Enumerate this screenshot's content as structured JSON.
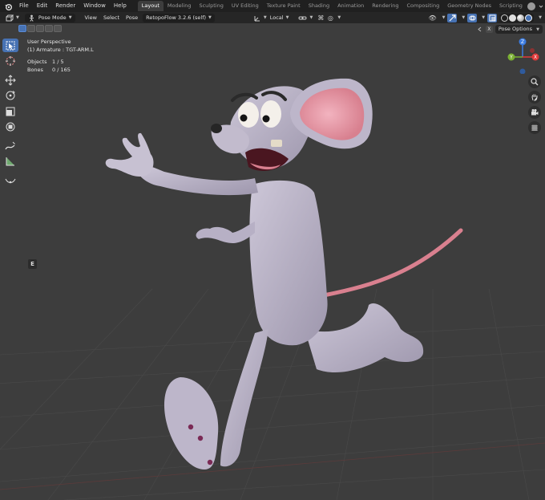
{
  "menu": {
    "items": [
      "File",
      "Edit",
      "Render",
      "Window",
      "Help"
    ]
  },
  "workspaces": {
    "tabs": [
      "Layout",
      "Modeling",
      "Sculpting",
      "UV Editing",
      "Texture Paint",
      "Shading",
      "Animation",
      "Rendering",
      "Compositing",
      "Geometry Nodes",
      "Scripting"
    ],
    "active": "Layout"
  },
  "header": {
    "mode": "Pose Mode",
    "view": "View",
    "select": "Select",
    "pose": "Pose",
    "addon": "RetopoFlow 3.2.6 (self)",
    "orientation": "Local"
  },
  "pose_options": {
    "label": "Pose Options",
    "close": "X"
  },
  "overlay": {
    "perspective": "User Perspective",
    "armature": "(1) Armature : TGT-ARM.L",
    "objects_label": "Objects",
    "objects_value": "1 / 5",
    "bones_label": "Bones",
    "bones_value": "0 / 165"
  },
  "gizmo": {
    "z": "Z",
    "y": "Y",
    "x": "X"
  },
  "tool_e_label": "E",
  "colors": {
    "accent": "#4772b3",
    "axis_x": "#e03a3a",
    "axis_y": "#7bb033",
    "axis_z": "#3a7be0",
    "mouse_body": "#b4adc2",
    "mouse_ear": "#e79aa8",
    "tail": "#d9808f"
  }
}
